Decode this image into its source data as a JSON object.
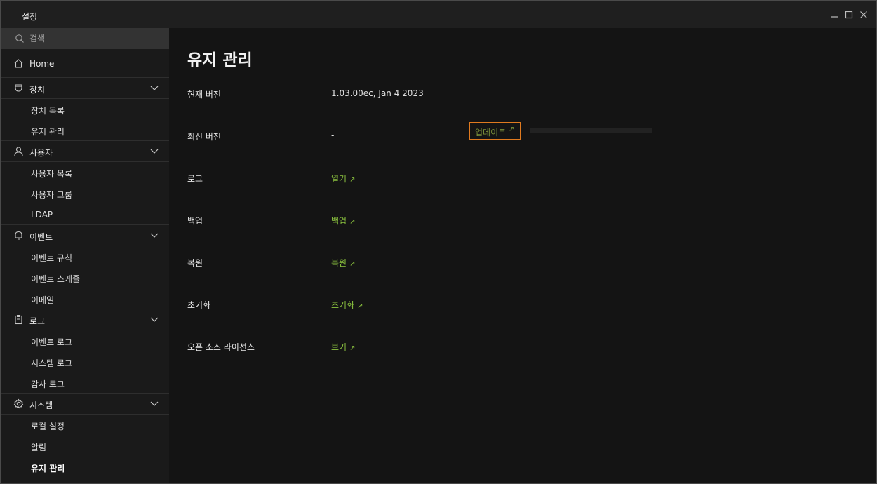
{
  "window": {
    "title": "설정"
  },
  "search": {
    "placeholder": "검색"
  },
  "sidebar": {
    "home": "Home",
    "groups": [
      {
        "label": "장치",
        "icon": "device-icon",
        "items": [
          "장치 목록",
          "유지 관리"
        ]
      },
      {
        "label": "사용자",
        "icon": "user-icon",
        "items": [
          "사용자 목록",
          "사용자 그룹",
          "LDAP"
        ]
      },
      {
        "label": "이벤트",
        "icon": "bell-icon",
        "items": [
          "이벤트 규칙",
          "이벤트 스케줄",
          "이메일"
        ]
      },
      {
        "label": "로그",
        "icon": "clipboard-icon",
        "items": [
          "이벤트 로그",
          "시스템 로그",
          "감사 로그"
        ]
      },
      {
        "label": "시스템",
        "icon": "gear-icon",
        "items": [
          "로컬 설정",
          "알림",
          "유지 관리"
        ]
      }
    ],
    "active_item": "유지 관리"
  },
  "main": {
    "title": "유지 관리",
    "current_version": {
      "label": "현재 버전",
      "value": "1.03.00ec, Jan  4 2023"
    },
    "latest_version": {
      "label": "최신 버전",
      "value": "-",
      "update_label": "업데이트",
      "progress": 0
    },
    "log": {
      "label": "로그",
      "link": "열기"
    },
    "backup": {
      "label": "백업",
      "link": "백업"
    },
    "restore": {
      "label": "복원",
      "link": "복원"
    },
    "reset": {
      "label": "초기화",
      "link": "초기화"
    },
    "license": {
      "label": "오픈 소스 라이선스",
      "link": "보기"
    },
    "link_arrow": "↗"
  },
  "colors": {
    "accent_link": "#8cc43f",
    "focus_outline": "#e07a1f",
    "background": "#141414",
    "sidebar": "#1a1a1a"
  }
}
